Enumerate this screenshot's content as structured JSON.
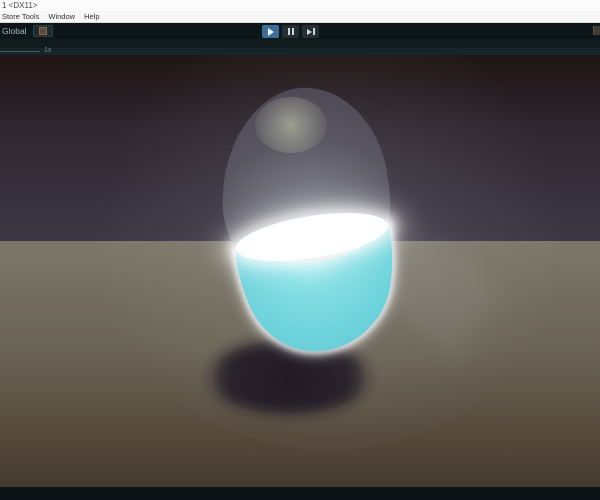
{
  "window": {
    "title_fragment": "1 <DX11>"
  },
  "menu_bar": {
    "items": [
      {
        "label": "Store Tools"
      },
      {
        "label": "Window"
      },
      {
        "label": "Help"
      }
    ]
  },
  "toolbar": {
    "global_label": "Global",
    "collab_icon": "grid-icon",
    "playback": {
      "play_state": "active",
      "buttons": [
        "play",
        "pause",
        "step"
      ]
    },
    "play_active_color": "#3c6d96"
  },
  "game_toolbar": {
    "scale_value": "1x"
  },
  "scene": {
    "description": "3D capsule containing glowing cyan liquid in play mode",
    "objects": [
      "glass-capsule",
      "liquid-surface",
      "liquid-body",
      "drop-shadow"
    ],
    "colors": {
      "wall_top": "#251a1c",
      "wall_bottom": "#3d3745",
      "floor_top": "#7d7769",
      "floor_bottom": "#453a2f",
      "glass": "#5b5a66",
      "liquid": "#70d4dd",
      "surface_glow": "#ffffff",
      "shadow": "#1f1724"
    }
  }
}
